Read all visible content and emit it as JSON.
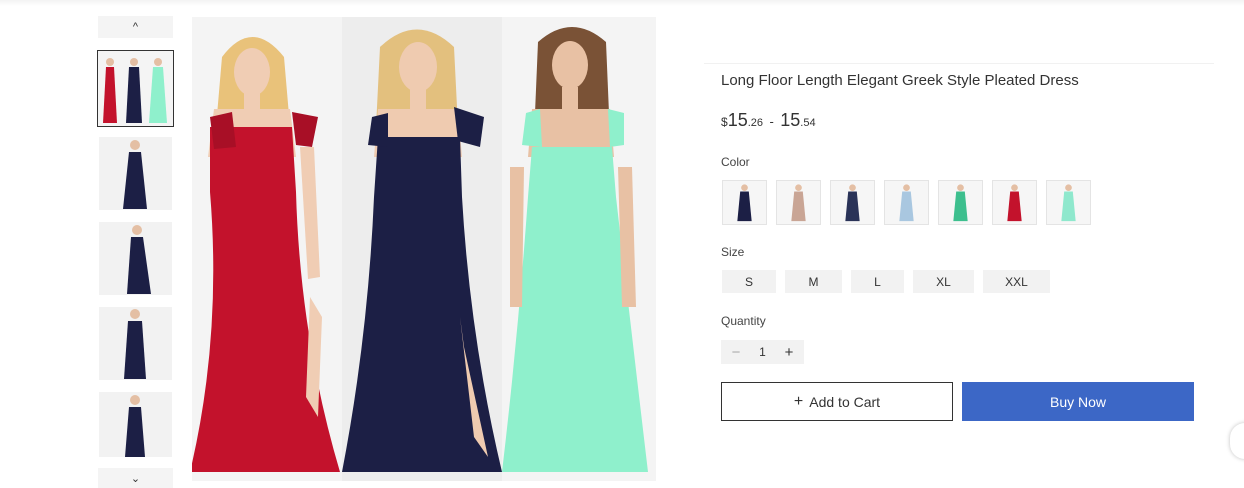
{
  "product": {
    "title": "Long Floor Length Elegant Greek Style Pleated Dress",
    "price": {
      "currency": "$",
      "low_main": "15",
      "low_cents": ".26",
      "separator": "-",
      "high_main": "15",
      "high_cents": ".54"
    }
  },
  "gallery": {
    "up_icon": "chevron-up-icon",
    "down_icon": "chevron-down-icon",
    "up_glyph": "^",
    "down_glyph": "⌄"
  },
  "color": {
    "label": "Color",
    "options": [
      {
        "name": "navy",
        "hex": "#1c1f45"
      },
      {
        "name": "blush",
        "hex": "#c9a595"
      },
      {
        "name": "floral-navy",
        "hex": "#2a3358"
      },
      {
        "name": "light-blue",
        "hex": "#a9c7e0"
      },
      {
        "name": "rainbow",
        "hex": "#3dbf8e"
      },
      {
        "name": "red",
        "hex": "#c3122c"
      },
      {
        "name": "mint",
        "hex": "#8fe8cd"
      }
    ]
  },
  "size": {
    "label": "Size",
    "options": [
      "S",
      "M",
      "L",
      "XL",
      "XXL"
    ]
  },
  "quantity": {
    "label": "Quantity",
    "minus": "−",
    "value": "1",
    "plus": "+"
  },
  "actions": {
    "add_to_cart_icon": "+",
    "add_to_cart": "Add to Cart",
    "buy_now": "Buy Now",
    "buy_now_color": "#3c67c6"
  },
  "dress_colors": {
    "red": "#c3122c",
    "navy": "#1c1f45",
    "mint": "#8ff0cc"
  }
}
